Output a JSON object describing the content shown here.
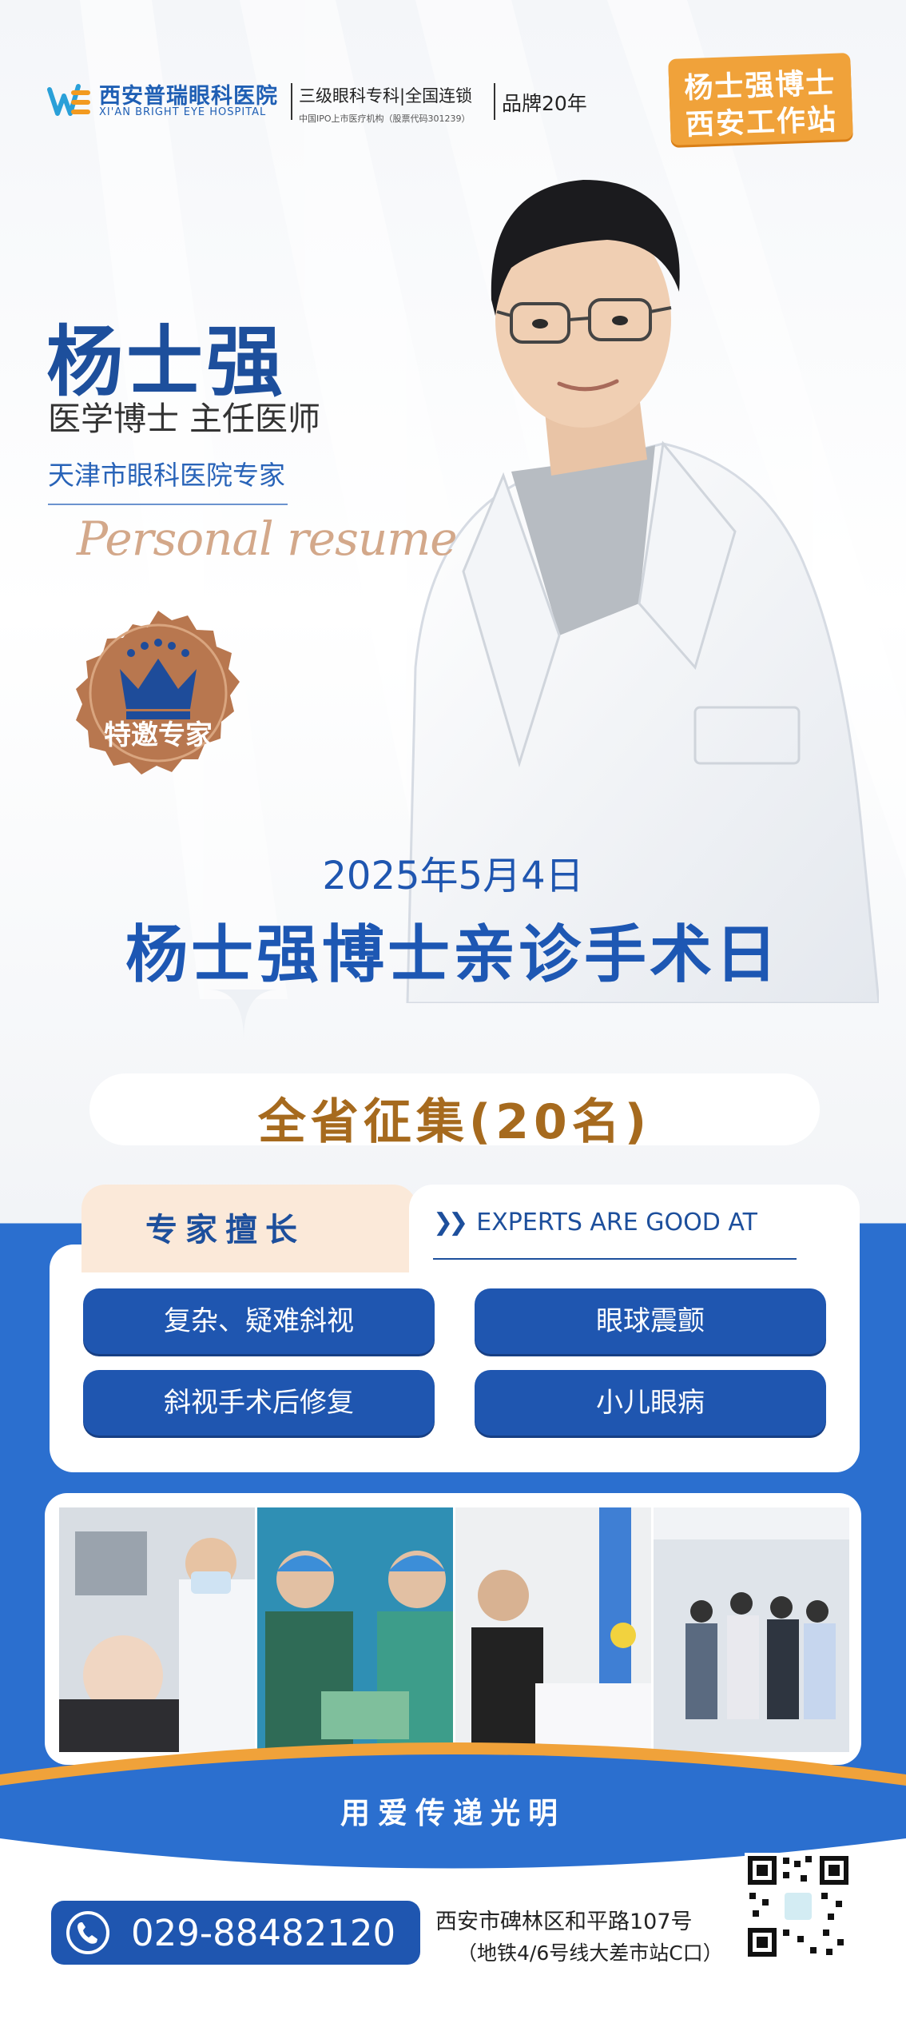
{
  "header": {
    "logo_cn": "西安普瑞眼科医院",
    "logo_en": "XI'AN BRIGHT EYE HOSPITAL",
    "tagline": "三级眼科专科|全国连锁",
    "tagline_sub": "中国IPO上市医疗机构（股票代码301239）",
    "brand": "品牌20年",
    "badge_line1": "杨士强博士",
    "badge_line2": "西安工作站"
  },
  "doctor": {
    "name": "杨士强",
    "title": "医学博士 主任医师",
    "affiliation": "天津市眼科医院专家",
    "script": "Personal resume",
    "seal_label": "特邀专家"
  },
  "event": {
    "date": "2025年5月4日",
    "title": "杨士强博士亲诊手术日",
    "recruit": "全省征集(20名)"
  },
  "expertise": {
    "tab_label": "专家擅长",
    "tab_en": "EXPERTS ARE GOOD AT",
    "items": [
      "复杂、疑难斜视",
      "眼球震颤",
      "斜视手术后修复",
      "小儿眼病"
    ]
  },
  "slogan": "用爱传递光明",
  "contact": {
    "phone": "029-88482120",
    "address_line1": "西安市碑林区和平路107号",
    "address_line2": "（地铁4/6号线大差市站C口）"
  },
  "colors": {
    "primary_blue": "#1f56b0",
    "accent_orange": "#f0a23a",
    "recruit_brown": "#a66a1e",
    "seal_bronze": "#b8774f"
  },
  "icons": [
    "logo-mark-icon",
    "crown-icon",
    "phone-icon",
    "qr-code-icon",
    "double-chevron-icon"
  ]
}
